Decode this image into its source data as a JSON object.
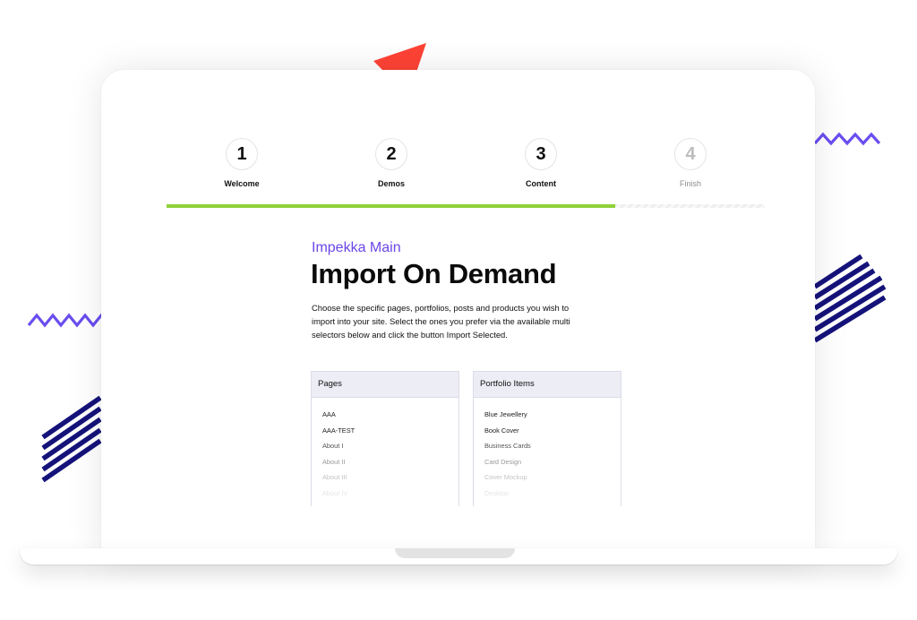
{
  "colors": {
    "accent_purple": "#6b46e6",
    "progress_green": "#8fd13a",
    "triangle_red": "#ff4336",
    "triangle_yellow": "#ffc642",
    "stripe_navy": "#15137a",
    "zigzag_purple": "#6a4df0"
  },
  "steps": [
    {
      "number": "1",
      "label": "Welcome"
    },
    {
      "number": "2",
      "label": "Demos"
    },
    {
      "number": "3",
      "label": "Content"
    },
    {
      "number": "4",
      "label": "Finish"
    }
  ],
  "progress": {
    "completed_fraction": 0.75
  },
  "main": {
    "subtitle": "Impekka Main",
    "title": "Import On Demand",
    "description": "Choose the specific pages, portfolios, posts and products you wish to import into your site. Select the ones you prefer via the available multi selectors below and click the button Import Selected."
  },
  "pages_panel": {
    "header": "Pages",
    "items": [
      "AAA",
      "AAA-TEST",
      "About I",
      "About II",
      "About III",
      "About IV"
    ]
  },
  "portfolio_panel": {
    "header": "Portfolio Items",
    "items": [
      "Blue Jewellery",
      "Book Cover",
      "Business Cards",
      "Card Design",
      "Cover Mockup",
      "Desktop"
    ]
  }
}
